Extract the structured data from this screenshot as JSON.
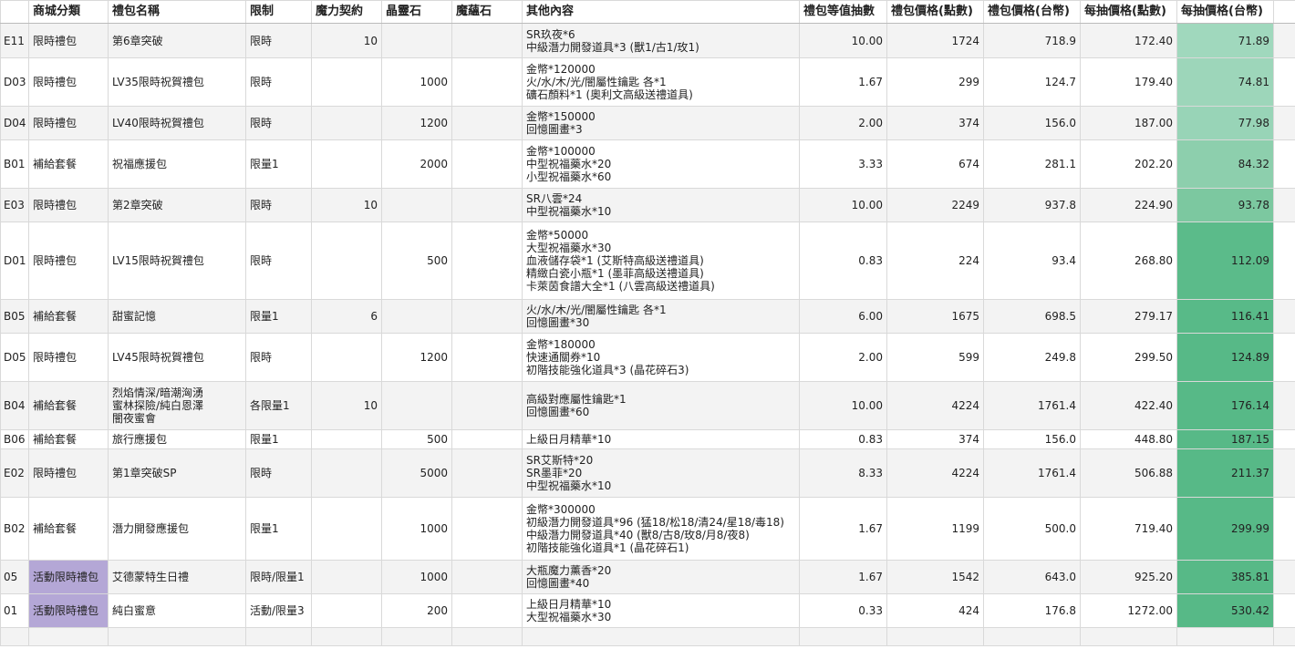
{
  "headers": [
    "",
    "商城分類",
    "禮包名稱",
    "限制",
    "魔力契約",
    "晶靈石",
    "魔蘊石",
    "其他內容",
    "禮包等值抽數",
    "禮包價格(點數)",
    "禮包價格(台幣)",
    "每抽價格(點數)",
    "每抽價格(台幣)"
  ],
  "rows": [
    {
      "id": "E11",
      "category": "限時禮包",
      "name": [
        "第6章突破"
      ],
      "limit": "限時",
      "contract": "10",
      "crystal": "",
      "magic": "",
      "content": [
        "SR玖夜*6",
        "中級潛力開發道具*3 (獸1/古1/玫1)"
      ],
      "draws": "10.00",
      "pts": "1724",
      "twd": "718.9",
      "per_pts": "172.40",
      "per_twd": "71.89",
      "color": "#a0d8bd"
    },
    {
      "id": "D03",
      "category": "限時禮包",
      "name": [
        "LV35限時祝賀禮包"
      ],
      "limit": "限時",
      "contract": "",
      "crystal": "1000",
      "magic": "",
      "content": [
        "金幣*120000",
        "火/水/木/光/闇屬性鑰匙 各*1",
        "礦石顏料*1 (奧利文高級送禮道具)"
      ],
      "draws": "1.67",
      "pts": "299",
      "twd": "124.7",
      "per_pts": "179.40",
      "per_twd": "74.81",
      "color": "#9dd6ba"
    },
    {
      "id": "D04",
      "category": "限時禮包",
      "name": [
        "LV40限時祝賀禮包"
      ],
      "limit": "限時",
      "contract": "",
      "crystal": "1200",
      "magic": "",
      "content": [
        "金幣*150000",
        "回憶圖畫*3"
      ],
      "draws": "2.00",
      "pts": "374",
      "twd": "156.0",
      "per_pts": "187.00",
      "per_twd": "77.98",
      "color": "#98d4b7"
    },
    {
      "id": "B01",
      "category": "補給套餐",
      "name": [
        "祝福應援包"
      ],
      "limit": "限量1",
      "contract": "",
      "crystal": "2000",
      "magic": "",
      "content": [
        "金幣*100000",
        "中型祝福藥水*20",
        "小型祝福藥水*60"
      ],
      "draws": "3.33",
      "pts": "674",
      "twd": "281.1",
      "per_pts": "202.20",
      "per_twd": "84.32",
      "color": "#8dcfad"
    },
    {
      "id": "E03",
      "category": "限時禮包",
      "name": [
        "第2章突破"
      ],
      "limit": "限時",
      "contract": "10",
      "crystal": "",
      "magic": "",
      "content": [
        "SR八雲*24",
        "中型祝福藥水*10"
      ],
      "draws": "10.00",
      "pts": "2249",
      "twd": "937.8",
      "per_pts": "224.90",
      "per_twd": "93.78",
      "color": "#7cc8a0"
    },
    {
      "id": "D01",
      "category": "限時禮包",
      "name": [
        "LV15限時祝賀禮包"
      ],
      "limit": "限時",
      "contract": "",
      "crystal": "500",
      "magic": "",
      "content": [
        "金幣*50000",
        "大型祝福藥水*30",
        "血液儲存袋*1 (艾斯特高級送禮道具)",
        "精緻白瓷小瓶*1 (墨菲高級送禮道具)",
        "卡萊茵食譜大全*1 (八雲高級送禮道具)"
      ],
      "draws": "0.83",
      "pts": "224",
      "twd": "93.4",
      "per_pts": "268.80",
      "per_twd": "112.09",
      "color": "#5bbb8a"
    },
    {
      "id": "B05",
      "category": "補給套餐",
      "name": [
        "甜蜜記憶"
      ],
      "limit": "限量1",
      "contract": "6",
      "crystal": "",
      "magic": "",
      "content": [
        "火/水/木/光/闇屬性鑰匙 各*1",
        "回憶圖畫*30"
      ],
      "draws": "6.00",
      "pts": "1675",
      "twd": "698.5",
      "per_pts": "279.17",
      "per_twd": "116.41",
      "color": "#58ba88"
    },
    {
      "id": "D05",
      "category": "限時禮包",
      "name": [
        "LV45限時祝賀禮包"
      ],
      "limit": "限時",
      "contract": "",
      "crystal": "1200",
      "magic": "",
      "content": [
        "金幣*180000",
        "快速通關券*10",
        "初階技能強化道具*3 (晶花碎石3)"
      ],
      "draws": "2.00",
      "pts": "599",
      "twd": "249.8",
      "per_pts": "299.50",
      "per_twd": "124.89",
      "color": "#57b987"
    },
    {
      "id": "B04",
      "category": "補給套餐",
      "name": [
        "烈焰情深/暗潮洶湧",
        "蜜林探險/純白恩澤",
        "闇夜蜜會"
      ],
      "limit": "各限量1",
      "contract": "10",
      "crystal": "",
      "magic": "",
      "content": [
        "高級對應屬性鑰匙*1",
        "回憶圖畫*60"
      ],
      "draws": "10.00",
      "pts": "4224",
      "twd": "1761.4",
      "per_pts": "422.40",
      "per_twd": "176.14",
      "color": "#57b987"
    },
    {
      "id": "B06",
      "category": "補給套餐",
      "name": [
        "旅行應援包"
      ],
      "limit": "限量1",
      "contract": "",
      "crystal": "500",
      "magic": "",
      "content": [
        "上級日月精華*10"
      ],
      "draws": "0.83",
      "pts": "374",
      "twd": "156.0",
      "per_pts": "448.80",
      "per_twd": "187.15",
      "color": "#57b987"
    },
    {
      "id": "E02",
      "category": "限時禮包",
      "name": [
        "第1章突破SP"
      ],
      "limit": "限時",
      "contract": "",
      "crystal": "5000",
      "magic": "",
      "content": [
        "SR艾斯特*20",
        "SR墨菲*20",
        "中型祝福藥水*10"
      ],
      "draws": "8.33",
      "pts": "4224",
      "twd": "1761.4",
      "per_pts": "506.88",
      "per_twd": "211.37",
      "color": "#57b987"
    },
    {
      "id": "B02",
      "category": "補給套餐",
      "name": [
        "潛力開發應援包"
      ],
      "limit": "限量1",
      "contract": "",
      "crystal": "1000",
      "magic": "",
      "content": [
        "金幣*300000",
        "初級潛力開發道具*96 (猛18/松18/清24/星18/毒18)",
        "中級潛力開發道具*40 (獸8/古8/玫8/月8/夜8)",
        "初階技能強化道具*1 (晶花碎石1)"
      ],
      "draws": "1.67",
      "pts": "1199",
      "twd": "500.0",
      "per_pts": "719.40",
      "per_twd": "299.99",
      "color": "#57b987"
    },
    {
      "id": "05",
      "category": "活動限時禮包",
      "purple": true,
      "name": [
        "艾德蒙特生日禮"
      ],
      "limit": "限時/限量1",
      "contract": "",
      "crystal": "1000",
      "magic": "",
      "content": [
        "大瓶魔力薰香*20",
        "回憶圖畫*40"
      ],
      "draws": "1.67",
      "pts": "1542",
      "twd": "643.0",
      "per_pts": "925.20",
      "per_twd": "385.81",
      "color": "#57b987"
    },
    {
      "id": "01",
      "category": "活動限時禮包",
      "purple": true,
      "name": [
        "純白蜜意"
      ],
      "limit": "活動/限量3",
      "contract": "",
      "crystal": "200",
      "magic": "",
      "content": [
        "上級日月精華*10",
        "大型祝福藥水*30"
      ],
      "draws": "0.33",
      "pts": "424",
      "twd": "176.8",
      "per_pts": "1272.00",
      "per_twd": "530.42",
      "color": "#57b987"
    }
  ]
}
